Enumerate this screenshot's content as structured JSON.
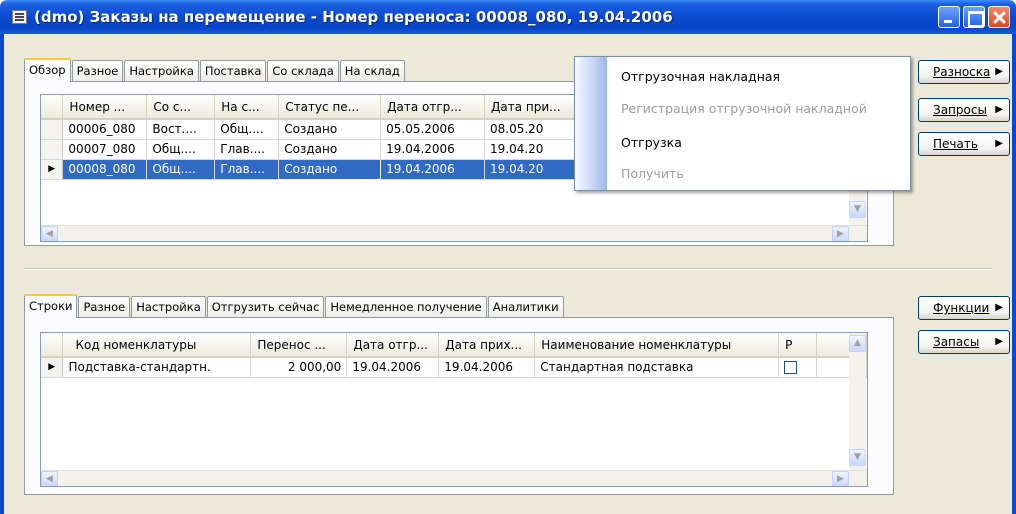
{
  "window": {
    "title": "(dmo) Заказы на перемещение - Номер переноса: 00008_080, 19.04.2006"
  },
  "top_tabs": [
    "Обзор",
    "Разное",
    "Настройка",
    "Поставка",
    "Со склада",
    "На склад"
  ],
  "top_grid": {
    "columns": [
      "Номер ...",
      "Со с...",
      "На с...",
      "Статус пе...",
      "Дата отгр...",
      "Дата при..."
    ],
    "rows": [
      [
        "00006_080",
        "Вост....",
        "Общ....",
        "Создано",
        "05.05.2006",
        "08.05.20"
      ],
      [
        "00007_080",
        "Общ....",
        "Глав....",
        "Создано",
        "19.04.2006",
        "19.04.20"
      ],
      [
        "00008_080",
        "Общ....",
        "Глав....",
        "Создано",
        "19.04.2006",
        "19.04.20"
      ]
    ],
    "selected_row": 2
  },
  "context_menu": {
    "items": [
      {
        "label": "Отгрузочная накладная",
        "enabled": true
      },
      {
        "label": "Регистрация отгрузочной накладной",
        "enabled": false
      },
      {
        "label": "Отгрузка",
        "enabled": true
      },
      {
        "label": "Получить",
        "enabled": false
      }
    ]
  },
  "side_buttons_top": [
    "Разноска",
    "Запросы",
    "Печать"
  ],
  "bottom_tabs": [
    "Строки",
    "Разное",
    "Настройка",
    "Отгрузить сейчас",
    "Немедленное получение",
    "Аналитики"
  ],
  "bottom_grid": {
    "columns": [
      "Код номенклатуры",
      "Перенос ...",
      "Дата отгр...",
      "Дата прих...",
      "Наименование номенклатуры",
      "Р"
    ],
    "rows": [
      [
        "Подставка-стандартн.",
        "2 000,00",
        "19.04.2006",
        "19.04.2006",
        "Стандартная подставка",
        ""
      ]
    ]
  },
  "side_buttons_bottom": [
    "Функции",
    "Запасы"
  ],
  "colors": {
    "titlebar": "#0a4ad0",
    "selection": "#316ac5",
    "window_face": "#ece9d8"
  }
}
